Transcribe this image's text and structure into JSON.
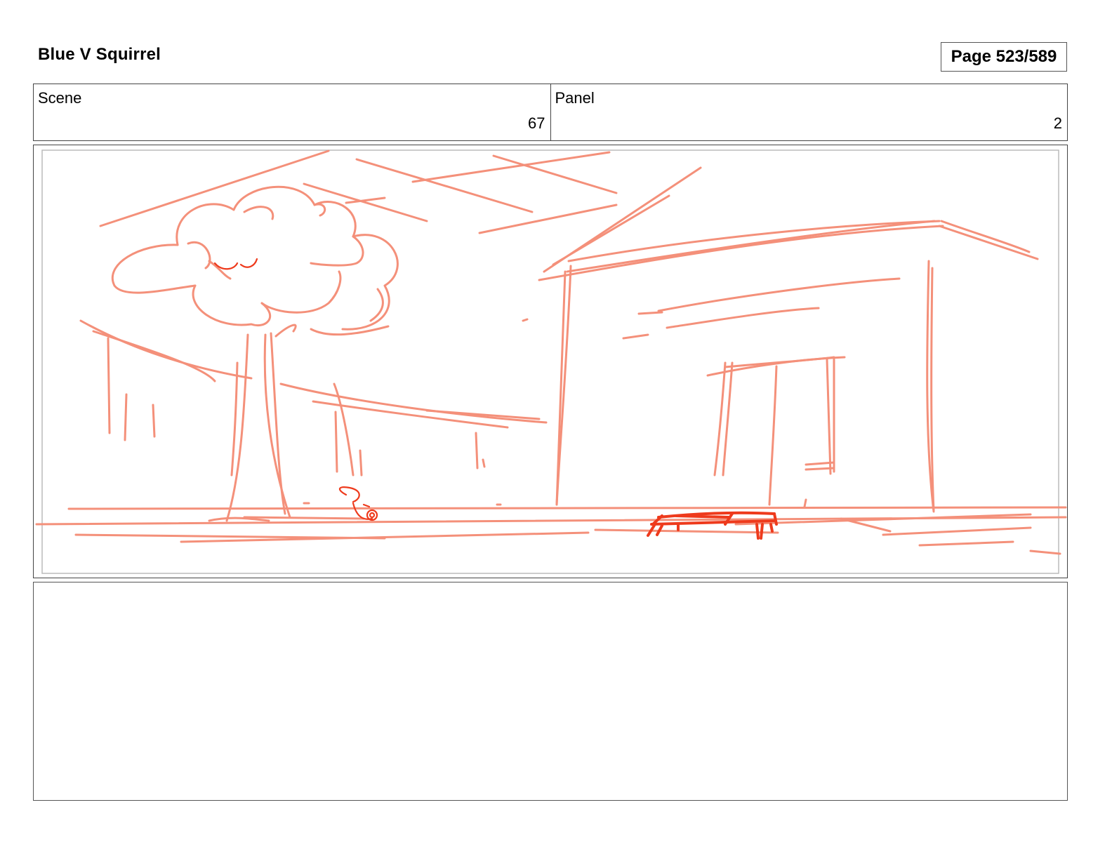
{
  "header": {
    "project_title": "Blue V Squirrel",
    "page_indicator": "Page 523/589"
  },
  "scene": {
    "label": "Scene",
    "value": "67"
  },
  "panel": {
    "label": "Panel",
    "value": "2"
  },
  "sketch": {
    "stroke_color": "#f4907a",
    "accent_color": "#ee3a1c"
  },
  "notes": {
    "text": ""
  }
}
